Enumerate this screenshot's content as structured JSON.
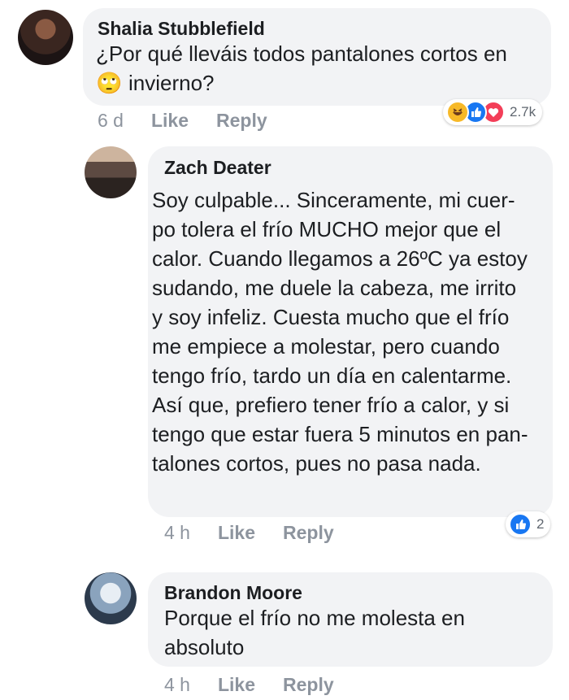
{
  "comments": [
    {
      "author": "Shalia Stubblefield",
      "text_line1": "¿Por qué lleváis todos pantalones cortos en",
      "text_line2": "invierno?",
      "emoji": "🙄",
      "time": "6 d",
      "like_label": "Like",
      "reply_label": "Reply",
      "reaction_count": "2.7k",
      "reaction_icons": [
        "haha-icon",
        "like-icon",
        "love-icon"
      ]
    },
    {
      "author": "Zach Deater",
      "text": "Soy culpable... Sinceramente, mi cuer-\npo tolera el frío MUCHO mejor que el\ncalor. Cuando llegamos a 26ºC ya estoy\nsudando, me duele la cabeza, me irrito\ny soy infeliz. Cuesta mucho que el frío\nme empiece a molestar, pero cuando\ntengo frío, tardo un día en calentarme.\nAsí que, prefiero tener frío a calor, y si\ntengo que estar fuera 5 minutos en pan-\ntalones cortos, pues no pasa nada.",
      "time": "4 h",
      "like_label": "Like",
      "reply_label": "Reply",
      "reaction_count": "2",
      "reaction_icons": [
        "like-icon"
      ]
    },
    {
      "author": "Brandon Moore",
      "text": "Porque el frío no me molesta en\nabsoluto",
      "time": "4 h",
      "like_label": "Like",
      "reply_label": "Reply"
    }
  ],
  "colors": {
    "bubble": "#f2f3f5",
    "meta": "#8d949e",
    "like_blue": "#1877f2",
    "love_red": "#f33e58",
    "haha_yellow": "#f7b928"
  }
}
